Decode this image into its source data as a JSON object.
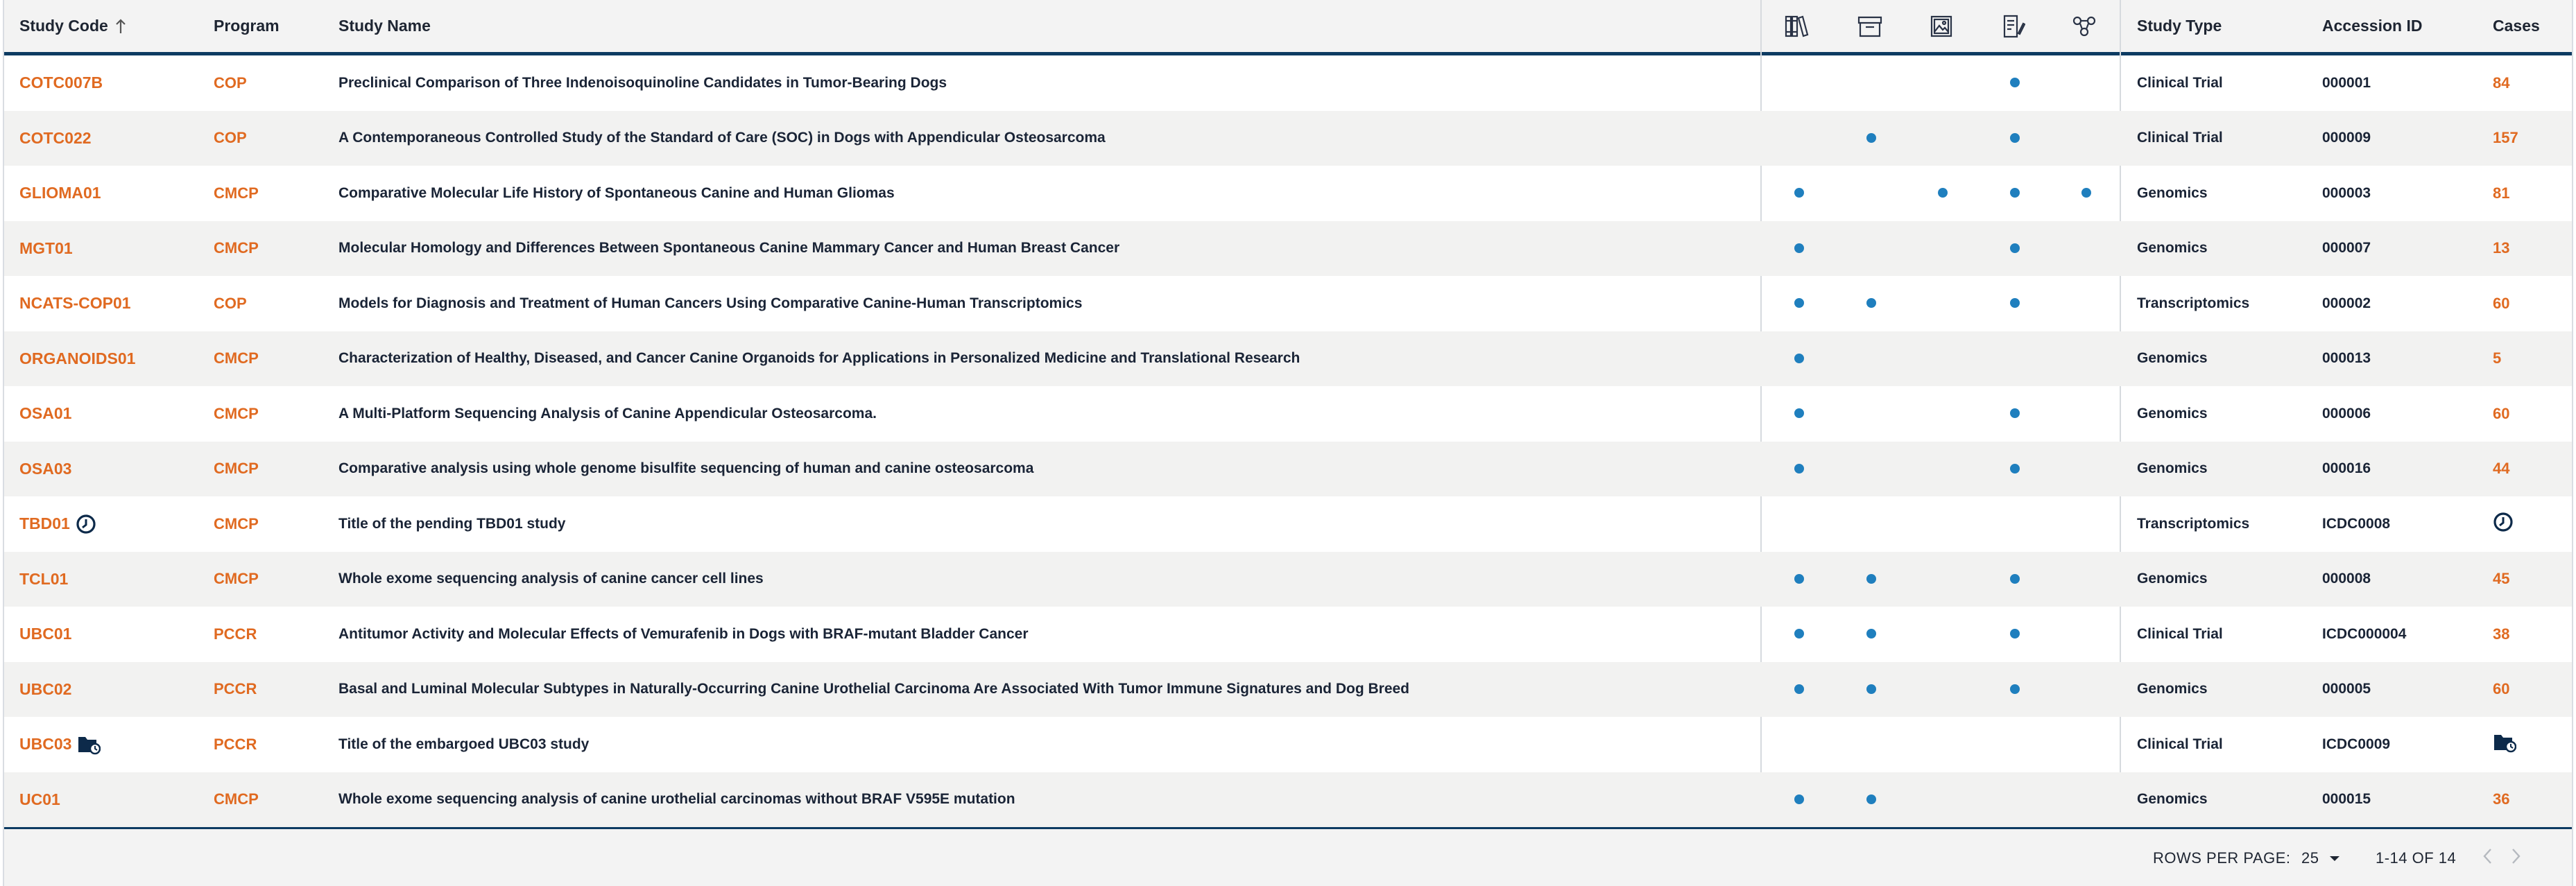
{
  "header": {
    "study_code": "Study Code",
    "program": "Program",
    "study_name": "Study Name",
    "study_type": "Study Type",
    "accession_id": "Accession ID",
    "cases": "Cases",
    "data_icons": [
      "publications-icon",
      "archive-icon",
      "image-icon",
      "document-icon",
      "molecule-icon"
    ]
  },
  "rows": [
    {
      "code": "COTC007B",
      "program": "COP",
      "name": "Preclinical Comparison of Three Indenoisoquinoline Candidates in Tumor-Bearing Dogs",
      "type": "Clinical Trial",
      "accession": "000001",
      "cases": "84",
      "dots": [
        false,
        false,
        false,
        true,
        false
      ]
    },
    {
      "code": "COTC022",
      "program": "COP",
      "name": "A Contemporaneous Controlled Study of the Standard of Care (SOC) in Dogs with Appendicular Osteosarcoma",
      "type": "Clinical Trial",
      "accession": "000009",
      "cases": "157",
      "dots": [
        false,
        true,
        false,
        true,
        false
      ]
    },
    {
      "code": "GLIOMA01",
      "program": "CMCP",
      "name": "Comparative Molecular Life History of Spontaneous Canine and Human Gliomas",
      "type": "Genomics",
      "accession": "000003",
      "cases": "81",
      "dots": [
        true,
        false,
        true,
        true,
        true
      ]
    },
    {
      "code": "MGT01",
      "program": "CMCP",
      "name": "Molecular Homology and Differences Between Spontaneous Canine Mammary Cancer and Human Breast Cancer",
      "type": "Genomics",
      "accession": "000007",
      "cases": "13",
      "dots": [
        true,
        false,
        false,
        true,
        false
      ]
    },
    {
      "code": "NCATS-COP01",
      "program": "COP",
      "name": "Models for Diagnosis and Treatment of Human Cancers Using Comparative Canine-Human Transcriptomics",
      "type": "Transcriptomics",
      "accession": "000002",
      "cases": "60",
      "dots": [
        true,
        true,
        false,
        true,
        false
      ]
    },
    {
      "code": "ORGANOIDS01",
      "program": "CMCP",
      "name": "Characterization of Healthy, Diseased, and Cancer Canine Organoids for Applications in Personalized Medicine and Translational Research",
      "type": "Genomics",
      "accession": "000013",
      "cases": "5",
      "dots": [
        true,
        false,
        false,
        false,
        false
      ]
    },
    {
      "code": "OSA01",
      "program": "CMCP",
      "name": "A Multi-Platform Sequencing Analysis of Canine Appendicular Osteosarcoma.",
      "type": "Genomics",
      "accession": "000006",
      "cases": "60",
      "dots": [
        true,
        false,
        false,
        true,
        false
      ]
    },
    {
      "code": "OSA03",
      "program": "CMCP",
      "name": "Comparative analysis using whole genome bisulfite sequencing of human and canine osteosarcoma",
      "type": "Genomics",
      "accession": "000016",
      "cases": "44",
      "dots": [
        true,
        false,
        false,
        true,
        false
      ]
    },
    {
      "code": "TBD01",
      "program": "CMCP",
      "name": "Title of the pending TBD01 study",
      "type": "Transcriptomics",
      "accession": "ICDC0008",
      "cases": "",
      "status_icon": "clock-icon",
      "dots": [
        false,
        false,
        false,
        false,
        false
      ]
    },
    {
      "code": "TCL01",
      "program": "CMCP",
      "name": "Whole exome sequencing analysis of canine cancer cell lines",
      "type": "Genomics",
      "accession": "000008",
      "cases": "45",
      "dots": [
        true,
        true,
        false,
        true,
        false
      ]
    },
    {
      "code": "UBC01",
      "program": "PCCR",
      "name": "Antitumor Activity and Molecular Effects of Vemurafenib in Dogs with BRAF-mutant Bladder Cancer",
      "type": "Clinical Trial",
      "accession": "ICDC000004",
      "cases": "38",
      "dots": [
        true,
        true,
        false,
        true,
        false
      ]
    },
    {
      "code": "UBC02",
      "program": "PCCR",
      "name": "Basal and Luminal Molecular Subtypes in Naturally-Occurring Canine Urothelial Carcinoma Are Associated With Tumor Immune Signatures and Dog Breed",
      "type": "Genomics",
      "accession": "000005",
      "cases": "60",
      "dots": [
        true,
        true,
        false,
        true,
        false
      ]
    },
    {
      "code": "UBC03",
      "program": "PCCR",
      "name": "Title of the embargoed UBC03 study",
      "type": "Clinical Trial",
      "accession": "ICDC0009",
      "cases": "",
      "status_icon": "embargo-folder-icon",
      "dots": [
        false,
        false,
        false,
        false,
        false
      ]
    },
    {
      "code": "UC01",
      "program": "CMCP",
      "name": "Whole exome sequencing analysis of canine urothelial carcinomas without BRAF V595E mutation",
      "type": "Genomics",
      "accession": "000015",
      "cases": "36",
      "dots": [
        true,
        true,
        false,
        false,
        false
      ]
    }
  ],
  "footer": {
    "rows_per_page_label": "ROWS PER PAGE:",
    "rows_per_page_value": "25",
    "range": "1-14 OF 14"
  },
  "colors": {
    "accent_orange": "#e06a21",
    "dot_blue": "#1f7fbe",
    "navy": "#0d3b62"
  }
}
